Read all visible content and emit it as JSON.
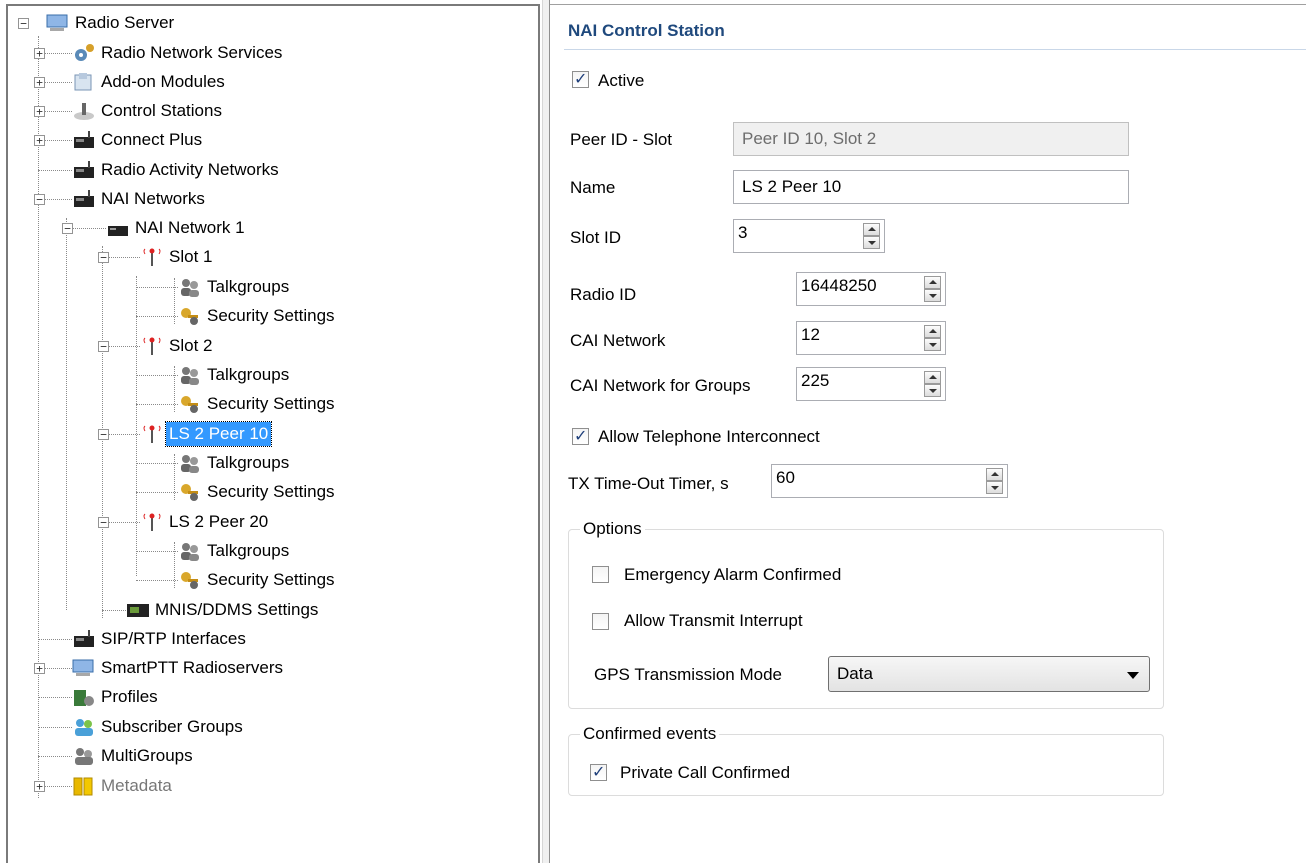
{
  "tree": {
    "items": [
      {
        "label": "Radio Server",
        "icon": "server-icon"
      },
      {
        "label": "Radio Network Services",
        "icon": "gear-network-icon"
      },
      {
        "label": "Add-on Modules",
        "icon": "modules-icon"
      },
      {
        "label": "Control Stations",
        "icon": "control-stations-icon"
      },
      {
        "label": "Connect Plus",
        "icon": "repeater-icon"
      },
      {
        "label": "Radio Activity Networks",
        "icon": "repeater-icon"
      },
      {
        "label": "NAI Networks",
        "icon": "repeater-icon"
      },
      {
        "label": "NAI Network 1",
        "icon": "network-icon"
      },
      {
        "label": "Slot 1",
        "icon": "antenna-icon"
      },
      {
        "label": "Talkgroups",
        "icon": "talkgroups-icon"
      },
      {
        "label": "Security Settings",
        "icon": "security-key-icon"
      },
      {
        "label": "Slot 2",
        "icon": "antenna-icon"
      },
      {
        "label": "Talkgroups",
        "icon": "talkgroups-icon"
      },
      {
        "label": "Security Settings",
        "icon": "security-key-icon"
      },
      {
        "label": "LS 2 Peer 10",
        "icon": "antenna-icon"
      },
      {
        "label": "Talkgroups",
        "icon": "talkgroups-icon"
      },
      {
        "label": "Security Settings",
        "icon": "security-key-icon"
      },
      {
        "label": "LS 2 Peer 20",
        "icon": "antenna-icon"
      },
      {
        "label": "Talkgroups",
        "icon": "talkgroups-icon"
      },
      {
        "label": "Security Settings",
        "icon": "security-key-icon"
      },
      {
        "label": "MNIS/DDMS Settings",
        "icon": "mnis-icon"
      },
      {
        "label": "SIP/RTP Interfaces",
        "icon": "repeater-icon"
      },
      {
        "label": "SmartPTT Radioservers",
        "icon": "server-icon"
      },
      {
        "label": "Profiles",
        "icon": "profiles-icon"
      },
      {
        "label": "Subscriber Groups",
        "icon": "subscriber-groups-icon"
      },
      {
        "label": "MultiGroups",
        "icon": "multigroups-icon"
      },
      {
        "label": "Metadata",
        "icon": "database-icon"
      }
    ],
    "selected_label": "LS 2 Peer 10"
  },
  "settings": {
    "title": "NAI Control Station",
    "active_label": "Active",
    "active_checked": true,
    "peer_slot_label": "Peer ID - Slot",
    "peer_slot_value": "Peer ID 10, Slot 2",
    "name_label": "Name",
    "name_value": "LS 2 Peer 10",
    "slot_id_label": "Slot ID",
    "slot_id_value": "3",
    "radio_id_label": "Radio ID",
    "radio_id_value": "16448250",
    "cai_network_label": "CAI Network",
    "cai_network_value": "12",
    "cai_groups_label": "CAI Network for Groups",
    "cai_groups_value": "225",
    "allow_tel_label": "Allow Telephone Interconnect",
    "allow_tel_checked": true,
    "tx_timeout_label": "TX Time-Out Timer, s",
    "tx_timeout_value": "60",
    "options": {
      "title": "Options",
      "emergency_label": "Emergency Alarm Confirmed",
      "emergency_checked": false,
      "interrupt_label": "Allow Transmit Interrupt",
      "interrupt_checked": false,
      "gps_label": "GPS Transmission Mode",
      "gps_value": "Data"
    },
    "confirmed": {
      "title": "Confirmed events",
      "private_call_label": "Private Call Confirmed",
      "private_call_checked": true
    }
  },
  "colors": {
    "title_blue": "#1f497d",
    "selection_blue": "#3399ff"
  }
}
